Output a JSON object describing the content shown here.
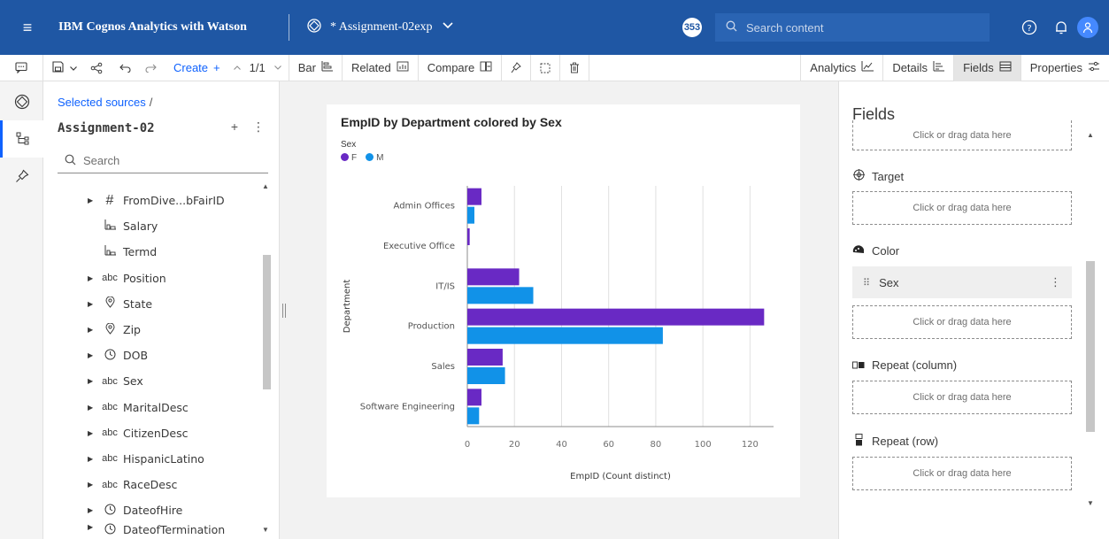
{
  "topbar": {
    "app_title": "IBM Cognos Analytics with Watson",
    "doc_title": "* Assignment-02exp",
    "notification_count": "353",
    "search_placeholder": "Search content"
  },
  "toolbar": {
    "create": "Create",
    "page": "1/1",
    "bar": "Bar",
    "related": "Related",
    "compare": "Compare",
    "analytics": "Analytics",
    "details": "Details",
    "fields": "Fields",
    "properties": "Properties"
  },
  "data_panel": {
    "breadcrumb": "Selected sources",
    "source_name": "Assignment-02",
    "search_placeholder": "Search",
    "items": [
      {
        "label": "FromDive...bFairID",
        "icon": "#",
        "caret": true
      },
      {
        "label": "Salary",
        "icon": "measure",
        "caret": false
      },
      {
        "label": "Termd",
        "icon": "measure",
        "caret": false
      },
      {
        "label": "Position",
        "icon": "abc",
        "caret": true
      },
      {
        "label": "State",
        "icon": "geo",
        "caret": true
      },
      {
        "label": "Zip",
        "icon": "geo",
        "caret": true
      },
      {
        "label": "DOB",
        "icon": "time",
        "caret": true
      },
      {
        "label": "Sex",
        "icon": "abc",
        "caret": true
      },
      {
        "label": "MaritalDesc",
        "icon": "abc",
        "caret": true
      },
      {
        "label": "CitizenDesc",
        "icon": "abc",
        "caret": true
      },
      {
        "label": "HispanicLatino",
        "icon": "abc",
        "caret": true
      },
      {
        "label": "RaceDesc",
        "icon": "abc",
        "caret": true
      },
      {
        "label": "DateofHire",
        "icon": "time",
        "caret": true
      },
      {
        "label": "DateofTermination",
        "icon": "time",
        "caret": true
      }
    ]
  },
  "chart_data": {
    "type": "bar",
    "orientation": "horizontal",
    "title": "EmpID by Department colored by Sex",
    "legend_title": "Sex",
    "xlabel": "EmpID (Count distinct)",
    "ylabel": "Department",
    "xlim": [
      0,
      130
    ],
    "xticks": [
      0,
      20,
      40,
      60,
      80,
      100,
      120
    ],
    "grid": true,
    "categories": [
      "Admin Offices",
      "Executive Office",
      "IT/IS",
      "Production",
      "Sales",
      "Software Engineering"
    ],
    "series": [
      {
        "name": "F",
        "color": "#6929c4",
        "values": [
          6,
          1,
          22,
          126,
          15,
          6
        ]
      },
      {
        "name": "M",
        "color": "#1192e8",
        "values": [
          3,
          0,
          28,
          83,
          16,
          5
        ]
      }
    ]
  },
  "fields_panel": {
    "title": "Fields",
    "dropzone_text": "Click or drag data here",
    "target_label": "Target",
    "color_label": "Color",
    "color_field": "Sex",
    "repeat_column_label": "Repeat (column)",
    "repeat_row_label": "Repeat (row)"
  }
}
